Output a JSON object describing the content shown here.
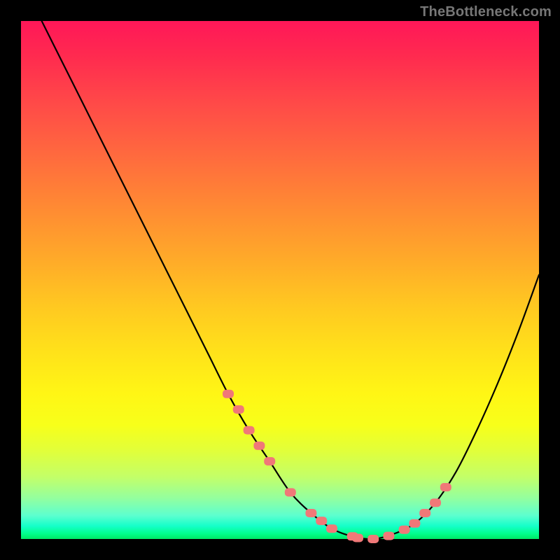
{
  "watermark": "TheBottleneck.com",
  "colors": {
    "background_black": "#000000",
    "curve_stroke": "#000000",
    "marker_fill": "#f07878",
    "watermark_text": "#777777"
  },
  "chart_data": {
    "type": "line",
    "title": "",
    "xlabel": "",
    "ylabel": "",
    "xlim": [
      0,
      100
    ],
    "ylim": [
      0,
      100
    ],
    "grid": false,
    "legend": false,
    "series": [
      {
        "name": "bottleneck-curve",
        "x": [
          4,
          8,
          12,
          16,
          20,
          24,
          28,
          32,
          36,
          40,
          44,
          48,
          52,
          56,
          60,
          64,
          68,
          72,
          76,
          80,
          84,
          88,
          92,
          96,
          100
        ],
        "y": [
          100,
          92,
          84,
          76,
          68,
          60,
          52,
          44,
          36,
          28,
          21,
          15,
          9,
          5,
          2,
          0.5,
          0,
          1,
          3,
          7,
          13,
          21,
          30,
          40,
          51
        ]
      }
    ],
    "markers": {
      "name": "highlighted-points",
      "x": [
        40,
        42,
        44,
        46,
        48,
        52,
        56,
        58,
        60,
        64,
        65,
        68,
        71,
        74,
        76,
        78,
        80,
        82
      ],
      "y": [
        28,
        25,
        21,
        18,
        15,
        9,
        5,
        3.5,
        2,
        0.5,
        0.2,
        0,
        0.6,
        1.8,
        3,
        5,
        7,
        10
      ]
    },
    "gradient_stops": [
      {
        "pos": 0.0,
        "color": "#ff1758"
      },
      {
        "pos": 0.07,
        "color": "#ff2b4f"
      },
      {
        "pos": 0.16,
        "color": "#ff4a48"
      },
      {
        "pos": 0.26,
        "color": "#ff6a3e"
      },
      {
        "pos": 0.36,
        "color": "#ff8a33"
      },
      {
        "pos": 0.46,
        "color": "#ffaa29"
      },
      {
        "pos": 0.55,
        "color": "#ffc821"
      },
      {
        "pos": 0.64,
        "color": "#ffe21a"
      },
      {
        "pos": 0.72,
        "color": "#fff615"
      },
      {
        "pos": 0.78,
        "color": "#f7ff1a"
      },
      {
        "pos": 0.83,
        "color": "#e1ff3a"
      },
      {
        "pos": 0.88,
        "color": "#c3ff68"
      },
      {
        "pos": 0.92,
        "color": "#95ff9d"
      },
      {
        "pos": 0.955,
        "color": "#5cffcf"
      },
      {
        "pos": 0.975,
        "color": "#15ffc9"
      },
      {
        "pos": 0.99,
        "color": "#00ff8b"
      },
      {
        "pos": 1.0,
        "color": "#00e865"
      }
    ]
  }
}
